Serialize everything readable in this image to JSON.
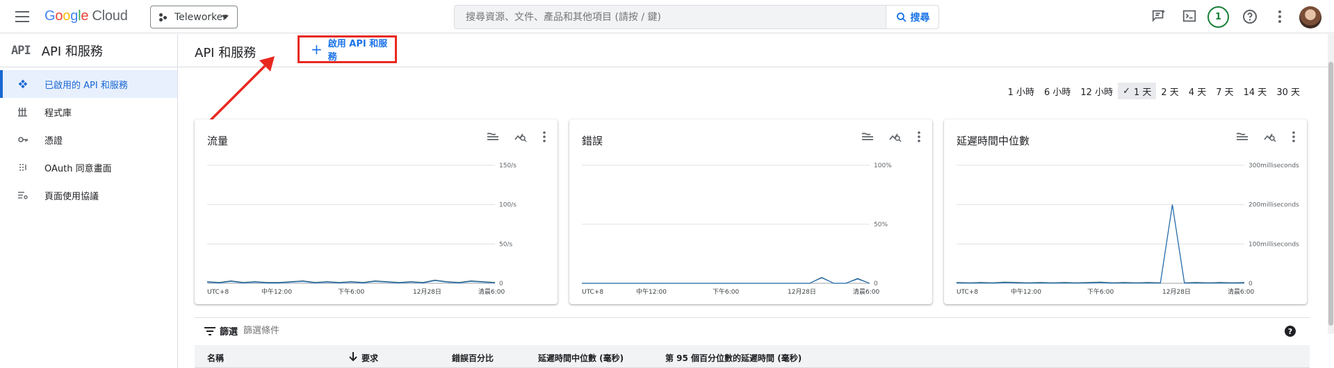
{
  "topbar": {
    "logo_google": [
      "G",
      "o",
      "o",
      "g",
      "l",
      "e"
    ],
    "logo_cloud": "Cloud",
    "project": "Teleworker",
    "search_placeholder": "搜尋資源、文件、產品和其他項目 (請按 / 鍵)",
    "search_button": "搜尋",
    "notification_count": "1"
  },
  "sidebar": {
    "logo": "API",
    "title": "API 和服務",
    "items": [
      {
        "label": "已啟用的 API 和服務",
        "icon": "api-diamond-icon",
        "active": true
      },
      {
        "label": "程式庫",
        "icon": "library-icon",
        "active": false
      },
      {
        "label": "憑證",
        "icon": "key-icon",
        "active": false
      },
      {
        "label": "OAuth 同意畫面",
        "icon": "oauth-icon",
        "active": false
      },
      {
        "label": "頁面使用協議",
        "icon": "settings-list-icon",
        "active": false
      }
    ]
  },
  "page": {
    "title": "API 和服務",
    "enable_button": "啟用 API 和服務"
  },
  "time_range": {
    "options": [
      "1 小時",
      "6 小時",
      "12 小時",
      "1 天",
      "2 天",
      "4 天",
      "7 天",
      "14 天",
      "30 天"
    ],
    "selected": "1 天"
  },
  "chart_data": [
    {
      "type": "line",
      "title": "流量",
      "y_ticks": [
        "150/s",
        "100/s",
        "50/s",
        "0"
      ],
      "ylim": [
        0,
        150
      ],
      "x_ticks": [
        "UTC+8",
        "中午12:00",
        "下午6:00",
        "12月28日",
        "清晨6:00"
      ],
      "series": [
        {
          "values": [
            2,
            1,
            3,
            1,
            2,
            1,
            1,
            2,
            3,
            1,
            2,
            1,
            2,
            1,
            3,
            2,
            1,
            2,
            1,
            4,
            2,
            1,
            3,
            2,
            1
          ]
        }
      ]
    },
    {
      "type": "line",
      "title": "錯誤",
      "y_ticks": [
        "100%",
        "50%",
        "0"
      ],
      "ylim": [
        0,
        100
      ],
      "x_ticks": [
        "UTC+8",
        "中午12:00",
        "下午6:00",
        "12月28日",
        "清晨6:00"
      ],
      "series": [
        {
          "values": [
            0,
            0,
            0,
            0,
            0,
            0,
            0,
            0,
            0,
            0,
            0,
            0,
            0,
            0,
            0,
            0,
            0,
            0,
            0,
            0,
            5,
            0,
            0,
            4,
            0
          ]
        }
      ]
    },
    {
      "type": "line",
      "title": "延遲時間中位數",
      "y_ticks": [
        "300milliseconds",
        "200milliseconds",
        "100milliseconds",
        "0"
      ],
      "ylim": [
        0,
        300
      ],
      "x_ticks": [
        "UTC+8",
        "中午12:00",
        "下午6:00",
        "12月28日",
        "清晨6:00"
      ],
      "series": [
        {
          "values": [
            2,
            1,
            2,
            1,
            3,
            2,
            1,
            2,
            1,
            2,
            1,
            2,
            3,
            1,
            2,
            1,
            2,
            1,
            200,
            1,
            2,
            1,
            2,
            1,
            2
          ]
        }
      ]
    }
  ],
  "filter": {
    "label": "篩選",
    "placeholder": "篩選條件"
  },
  "table": {
    "columns": [
      "名稱",
      "要求",
      "錯誤百分比",
      "延遲時間中位數 (毫秒)",
      "第 95 個百分位數的延遲時間 (毫秒)"
    ]
  },
  "colors": {
    "accent": "#1a73e8",
    "highlight_box": "#e8281f",
    "series_line": "#1e5a6e"
  }
}
